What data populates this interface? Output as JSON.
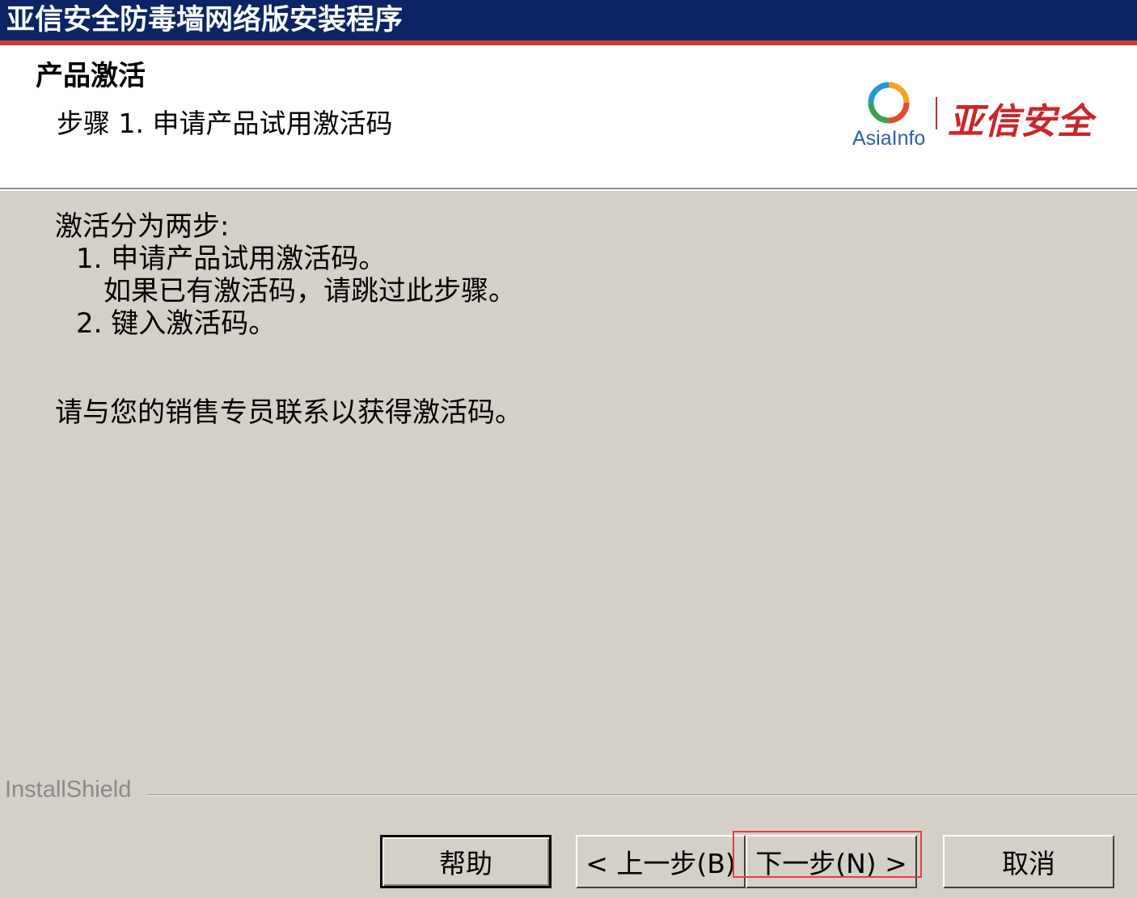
{
  "window": {
    "title": "亚信安全防毒墙网络版安装程序"
  },
  "header": {
    "title": "产品激活",
    "subtitle": "步骤 1. 申请产品试用激活码",
    "logo": {
      "text_en": "AsiaInfo",
      "text_cn": "亚信安全",
      "ring_colors": [
        "#f6a31b",
        "#e44a2c",
        "#3aa24f",
        "#1f9ad6"
      ]
    }
  },
  "content": {
    "intro": "激活分为两步:",
    "step1": "1. 申请产品试用激活码。",
    "step1_note": "如果已有激活码，请跳过此步骤。",
    "step2": "2. 键入激活码。",
    "contact": "请与您的销售专员联系以获得激活码。"
  },
  "footer": {
    "brand": "InstallShield",
    "buttons": {
      "help": "帮助",
      "back": "< 上一步(B)",
      "next": "下一步(N) >",
      "cancel": "取消"
    }
  },
  "colors": {
    "titlebar": "#0b2463",
    "accent_bar": "#c64032",
    "dialog_bg": "#d4d0c8"
  }
}
